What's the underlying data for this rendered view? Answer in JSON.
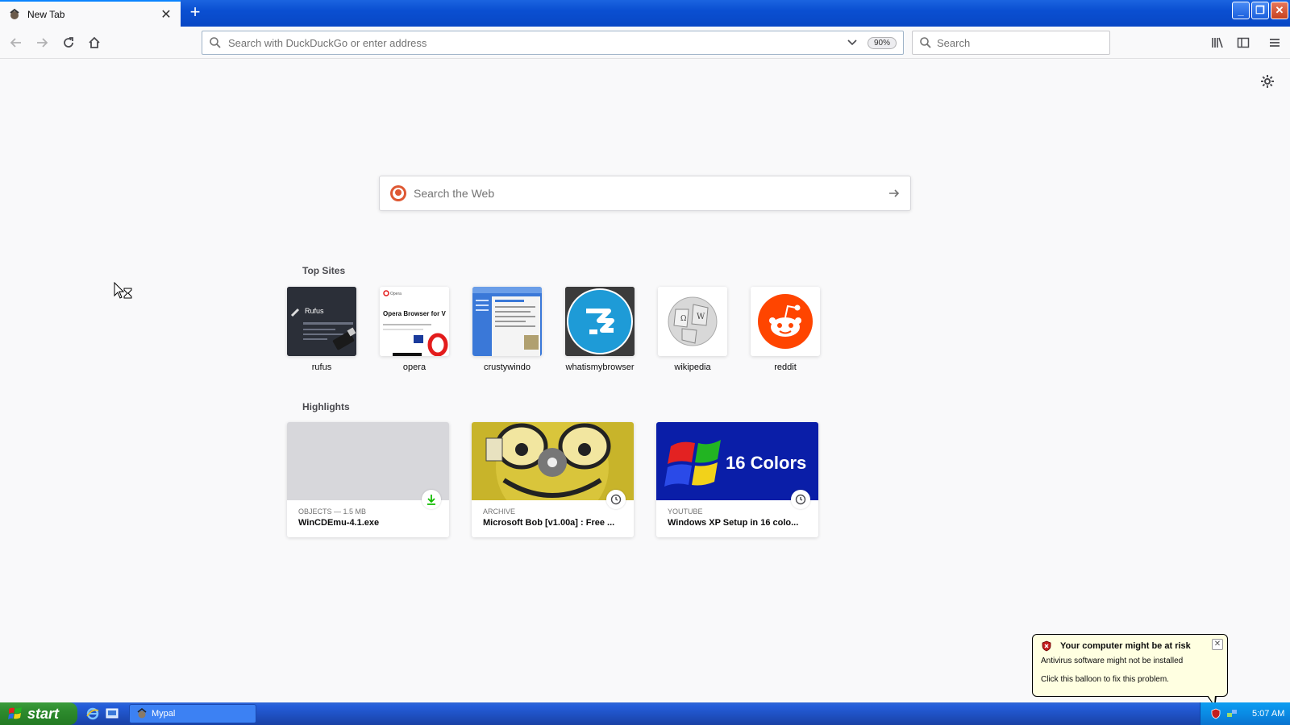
{
  "browser": {
    "tab": {
      "title": "New Tab"
    },
    "urlbar": {
      "placeholder": "Search with DuckDuckGo or enter address",
      "zoom": "90%"
    },
    "searchbar": {
      "placeholder": "Search"
    }
  },
  "newtab": {
    "web_search": {
      "placeholder": "Search the Web"
    },
    "top_sites": {
      "title": "Top Sites",
      "items": [
        {
          "label": "rufus"
        },
        {
          "label": "opera"
        },
        {
          "label": "crustywindo"
        },
        {
          "label": "whatismybrowser"
        },
        {
          "label": "wikipedia"
        },
        {
          "label": "reddit"
        }
      ]
    },
    "highlights": {
      "title": "Highlights",
      "items": [
        {
          "context": "OBJECTS — 1.5 MB",
          "title": "WinCDEmu-4.1.exe"
        },
        {
          "context": "ARCHIVE",
          "title": "Microsoft Bob [v1.00a] : Free ..."
        },
        {
          "context": "YOUTUBE",
          "title": "Windows XP Setup in 16 colo..."
        }
      ]
    },
    "thumbs": {
      "rufus_text": "Rufus",
      "opera_text": "Opera Browser for V",
      "opera_brand": "Opera",
      "xp_text": "16 Colors"
    }
  },
  "balloon": {
    "title": "Your computer might be at risk",
    "message": "Antivirus software might not be installed",
    "action": "Click this balloon to fix this problem."
  },
  "taskbar": {
    "start_label": "start",
    "task_label": "Mypal",
    "clock": "5:07 AM"
  },
  "colors": {
    "accent": "#0a84ff",
    "taskbar": "#245edb",
    "start": "#2d8a2d",
    "reddit": "#ff4500"
  }
}
